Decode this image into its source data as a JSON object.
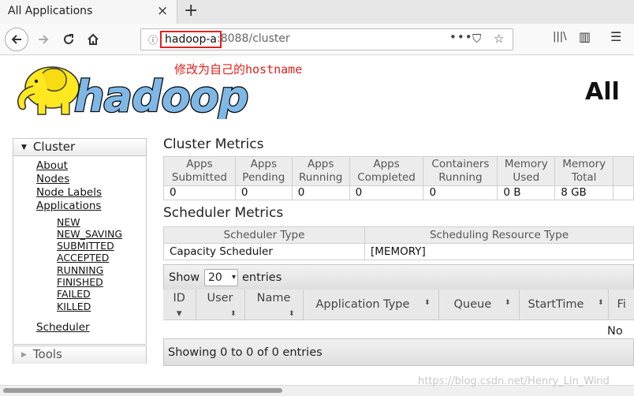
{
  "browser": {
    "tab_title": "All Applications",
    "tab_close": "×",
    "new_tab": "+",
    "url_host": "hadoop-a",
    "url_rest": ":8088/cluster",
    "url_info_glyph": "ⓘ",
    "page_actions_glyph": "•••",
    "pocket_glyph": "⛉",
    "bookmark_glyph": "☆",
    "library_glyph": "|||\\",
    "sidebar_glyph": "▥",
    "menu_glyph": "☰"
  },
  "annotation": "修改为自己的hostname",
  "logo_text": "hadoop",
  "page_heading": "All",
  "sidebar": {
    "cluster": {
      "label": "Cluster",
      "links": [
        "About",
        "Nodes",
        "Node Labels",
        "Applications"
      ],
      "app_states": [
        "NEW",
        "NEW_SAVING",
        "SUBMITTED",
        "ACCEPTED",
        "RUNNING",
        "FINISHED",
        "FAILED",
        "KILLED"
      ],
      "scheduler": "Scheduler"
    },
    "tools": {
      "label": "Tools"
    }
  },
  "cluster_metrics": {
    "title": "Cluster Metrics",
    "headers": [
      [
        "Apps",
        "Submitted"
      ],
      [
        "Apps",
        "Pending"
      ],
      [
        "Apps",
        "Running"
      ],
      [
        "Apps",
        "Completed"
      ],
      [
        "Containers",
        "Running"
      ],
      [
        "Memory",
        "Used"
      ],
      [
        "Memory",
        "Total"
      ]
    ],
    "values": [
      "0",
      "0",
      "0",
      "0",
      "0",
      "0 B",
      "8 GB"
    ]
  },
  "scheduler_metrics": {
    "title": "Scheduler Metrics",
    "headers": [
      "Scheduler Type",
      "Scheduling Resource Type"
    ],
    "values": [
      "Capacity Scheduler",
      "[MEMORY]"
    ]
  },
  "apps_table": {
    "show_label": "Show",
    "page_size": "20",
    "entries_label": "entries",
    "columns": [
      "ID",
      "User",
      "Name",
      "Application Type",
      "Queue",
      "StartTime",
      "Fi"
    ],
    "no_data": "No",
    "info": "Showing 0 to 0 of 0 entries"
  },
  "watermark": "https://blog.csdn.net/Henry_Lin_Wind"
}
